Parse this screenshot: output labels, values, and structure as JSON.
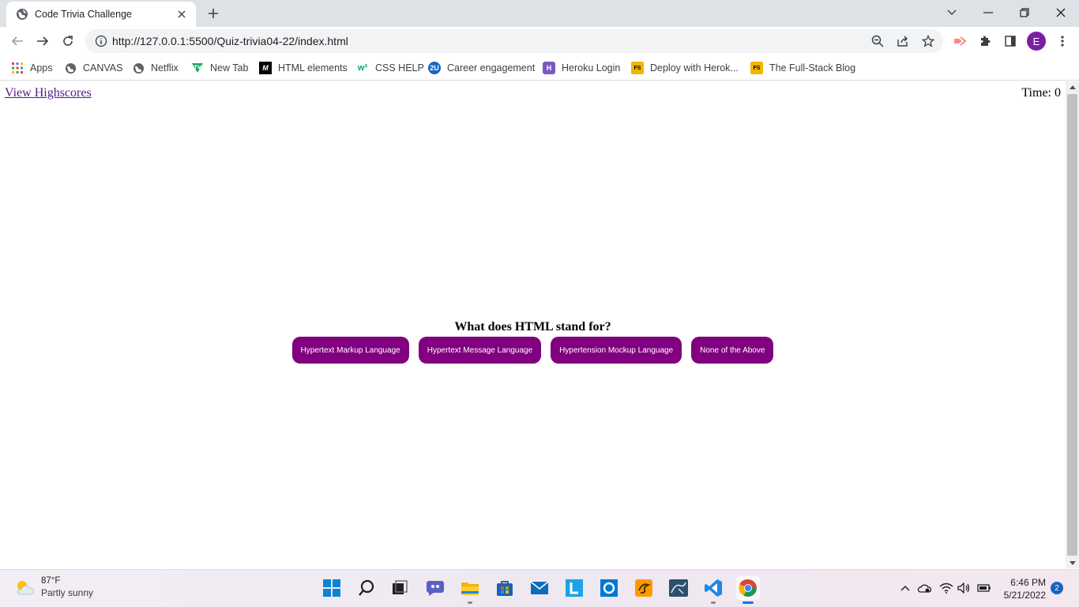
{
  "browser": {
    "tab": {
      "title": "Code Trivia Challenge"
    },
    "url": "http://127.0.0.1:5500/Quiz-trivia04-22/index.html",
    "profile_initial": "E",
    "bookmarks": [
      {
        "label": "Apps",
        "icon": "apps-grid-icon"
      },
      {
        "label": "CANVAS",
        "icon": "globe-icon"
      },
      {
        "label": "Netflix",
        "icon": "globe-icon"
      },
      {
        "label": "New Tab",
        "icon": "tv-icon"
      },
      {
        "label": "HTML elements",
        "icon": "m-logo-icon"
      },
      {
        "label": "CSS HELP",
        "icon": "w3-logo-icon"
      },
      {
        "label": "Career engagement",
        "icon": "2u-logo-icon"
      },
      {
        "label": "Heroku Login",
        "icon": "heroku-logo-icon"
      },
      {
        "label": "Deploy with Herok...",
        "icon": "fs-logo-icon"
      },
      {
        "label": "The Full-Stack Blog",
        "icon": "fs-logo-icon"
      }
    ]
  },
  "page": {
    "highscores_link": "View Highscores",
    "timer_label": "Time:",
    "timer_value": "0",
    "question": "What does HTML stand for?",
    "answers": [
      "Hypertext Markup Language",
      "Hypertext Message Language",
      "Hypertension Mockup Language",
      "None of the Above"
    ],
    "colors": {
      "answer_button": "#800080",
      "link": "#551a8b"
    }
  },
  "taskbar": {
    "weather": {
      "temp": "87°F",
      "condition": "Partly sunny"
    },
    "apps": [
      "start-icon",
      "search-icon",
      "task-view-icon",
      "chat-icon",
      "file-explorer-icon",
      "store-icon",
      "mail-icon",
      "l-app-icon",
      "cortana-icon",
      "sublime-icon",
      "mysql-icon",
      "vscode-icon",
      "chrome-icon"
    ],
    "clock": {
      "time": "6:46 PM",
      "date": "5/21/2022"
    },
    "notifications": "2"
  }
}
